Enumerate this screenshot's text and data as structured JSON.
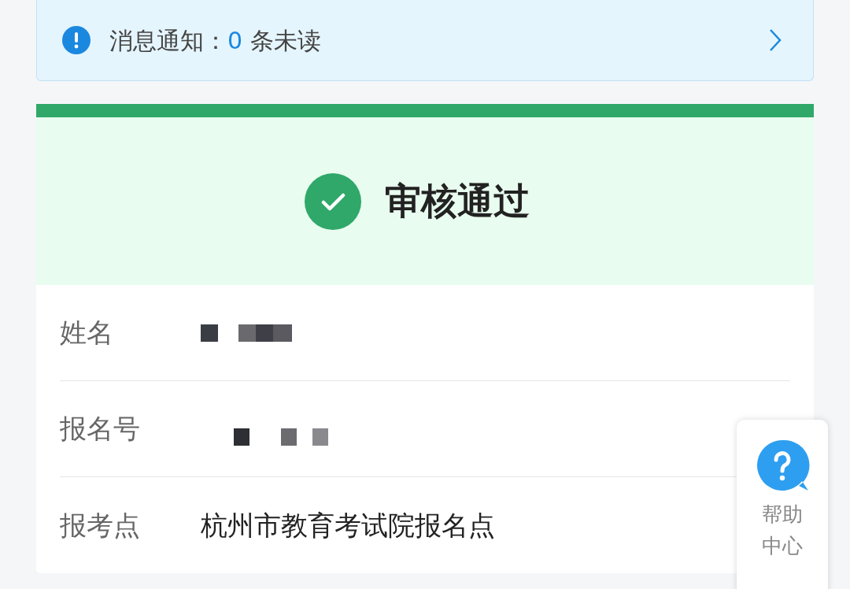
{
  "notice": {
    "label": "消息通知：",
    "count": "0",
    "suffix": "条未读"
  },
  "status": {
    "title": "审核通过",
    "kind": "approved"
  },
  "fields": [
    {
      "label": "姓名",
      "kind": "redacted"
    },
    {
      "label": "报名号",
      "kind": "redacted"
    },
    {
      "label": "报考点",
      "kind": "text",
      "value": "杭州市教育考试院报名点"
    }
  ],
  "help": {
    "label": "帮助中心"
  }
}
